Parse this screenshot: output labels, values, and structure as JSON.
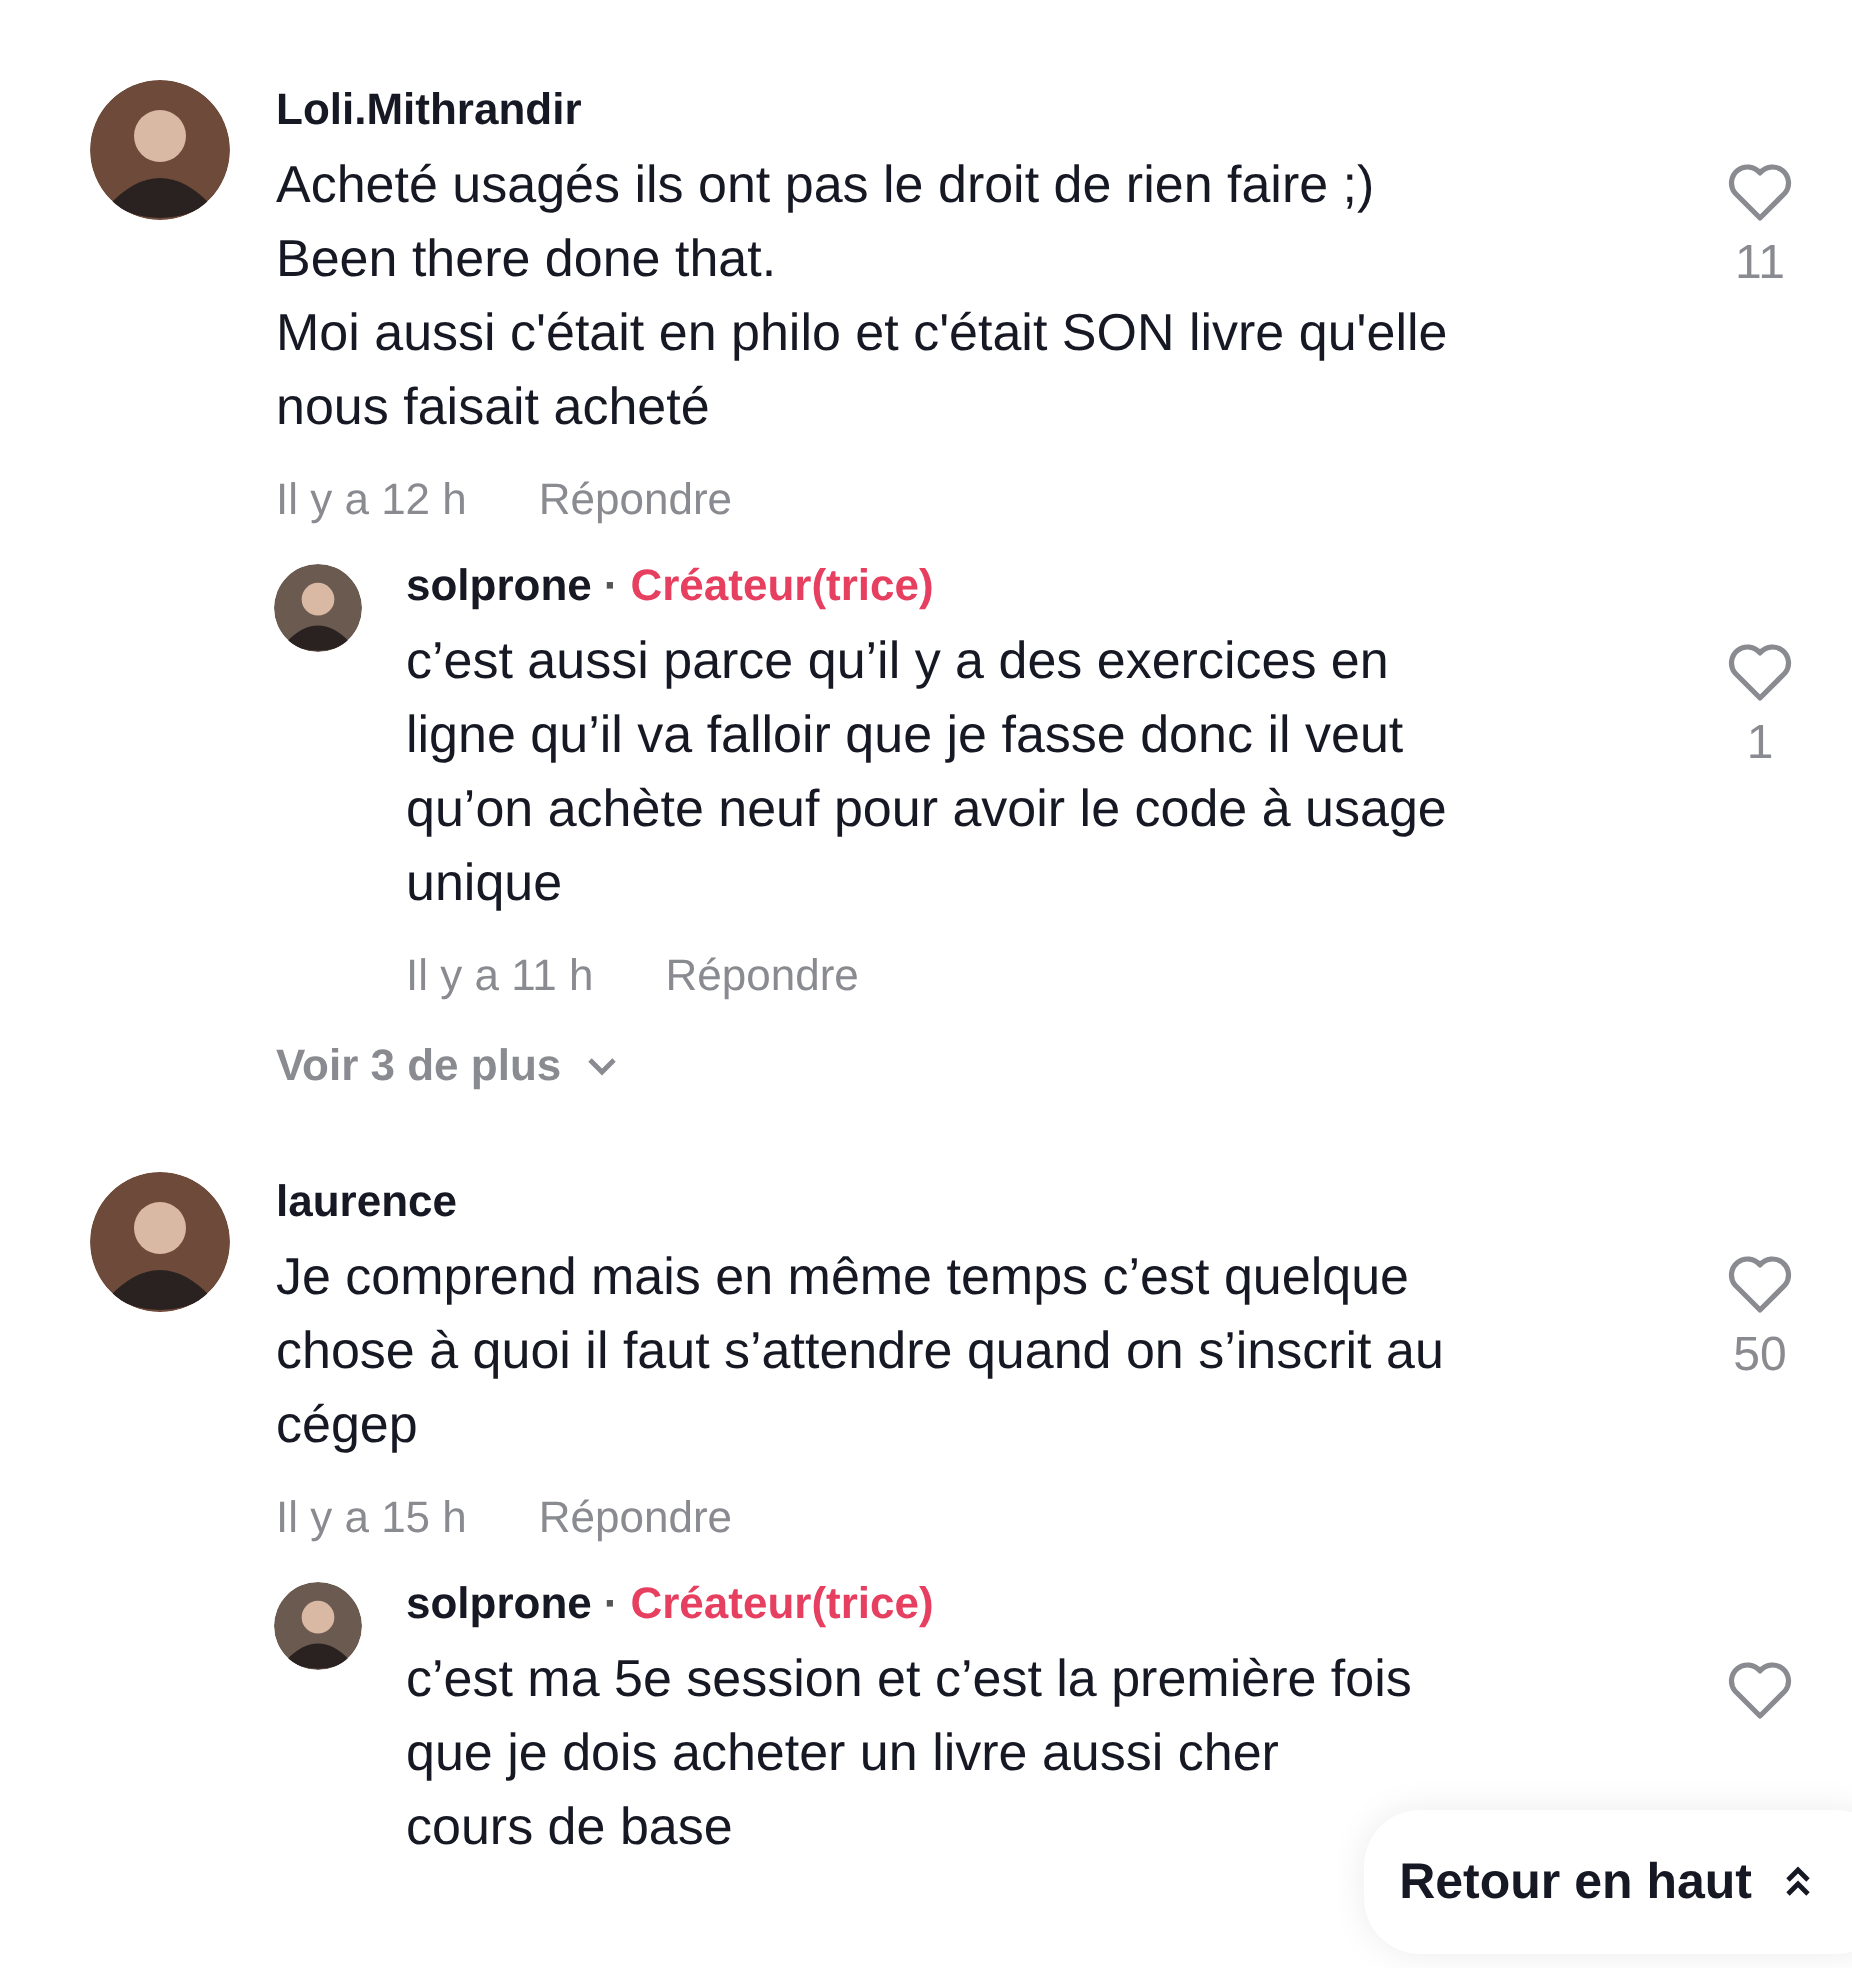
{
  "comments": [
    {
      "user": "Loli.Mithrandir",
      "lines": [
        "Acheté usagés ils ont pas le droit de rien faire ;)",
        "Been there done that.",
        "Moi aussi c'était en philo et c'était SON livre qu'elle",
        "nous faisait acheté"
      ],
      "likes": "11",
      "time": "Il y a 12 h",
      "reply": "Répondre",
      "children": [
        {
          "user": "solprone",
          "badge": "Créateur(trice)",
          "lines": [
            "c’est aussi parce qu’il y a des exercices en",
            "ligne qu’il va falloir que je fasse donc il veut",
            "qu’on achète neuf pour avoir le code à usage",
            "unique"
          ],
          "likes": "1",
          "time": "Il y a 11 h",
          "reply": "Répondre",
          "separator": "·"
        }
      ],
      "more": "Voir 3 de plus"
    },
    {
      "user": "laurence",
      "lines": [
        "Je comprend mais en même temps c’est quelque",
        "chose à quoi il faut s’attendre quand on s’inscrit au",
        "cégep"
      ],
      "likes": "50",
      "time": "Il y a 15 h",
      "reply": "Répondre",
      "children": [
        {
          "user": "solprone",
          "badge": "Créateur(trice)",
          "lines": [
            "c’est ma 5e session et c’est la première fois",
            "que je dois acheter un livre aussi cher",
            "cours de base"
          ],
          "separator": "·"
        }
      ]
    }
  ],
  "back_to_top": "Retour en haut"
}
